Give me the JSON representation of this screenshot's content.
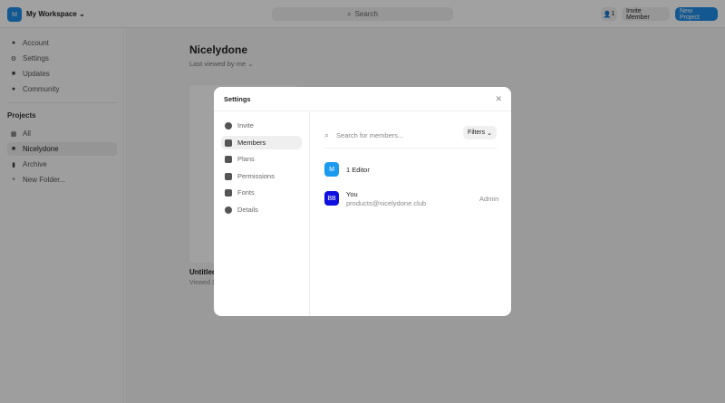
{
  "topbar": {
    "workspace_initial": "M",
    "workspace_name": "My Workspace",
    "search": "Search",
    "member_count": "1",
    "invite": "Invite Member",
    "new_project": "New Project"
  },
  "sidebar": {
    "items": [
      {
        "label": "Account"
      },
      {
        "label": "Settings"
      },
      {
        "label": "Updates"
      },
      {
        "label": "Community"
      }
    ],
    "projects_heading": "Projects",
    "projects": [
      {
        "label": "All"
      },
      {
        "label": "Nicelydone"
      },
      {
        "label": "Archive"
      },
      {
        "label": "New Folder..."
      }
    ]
  },
  "main": {
    "title": "Nicelydone",
    "sort": "Last viewed by me",
    "card_title": "Untitled",
    "card_sub": "Viewed 1"
  },
  "modal": {
    "title": "Settings",
    "nav": [
      {
        "label": "Invite"
      },
      {
        "label": "Members"
      },
      {
        "label": "Plans"
      },
      {
        "label": "Permissions"
      },
      {
        "label": "Fonts"
      },
      {
        "label": "Details"
      }
    ],
    "search_placeholder": "Search for members...",
    "filters": "Filters",
    "rows": [
      {
        "initials": "M",
        "name": "1 Editor",
        "color": "#1a9bf0"
      },
      {
        "initials": "BB",
        "name": "You",
        "email": "products@nicelydone.club",
        "role": "Admin",
        "color": "#1010e0"
      }
    ]
  }
}
